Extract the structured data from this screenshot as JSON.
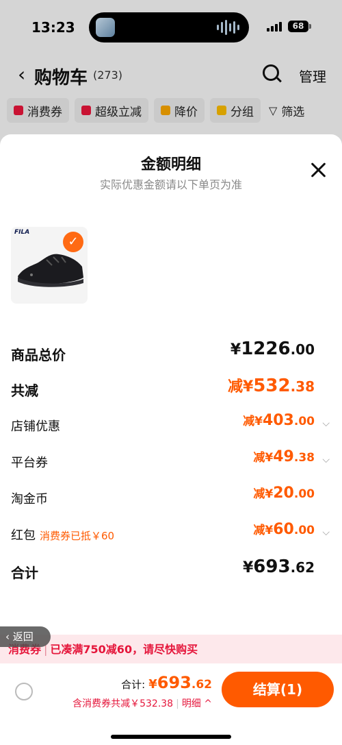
{
  "status_bar": {
    "time": "13:23",
    "battery": "68"
  },
  "nav": {
    "back_icon": "chevron-left-icon",
    "title": "购物车",
    "count": "(273)",
    "manage": "管理"
  },
  "filters": [
    {
      "label": "消费券",
      "icon": "coupon-icon",
      "color": "#e5163b"
    },
    {
      "label": "超级立减",
      "icon": "arrow-down-icon",
      "color": "#e5163b"
    },
    {
      "label": "降价",
      "icon": "price-drop-icon",
      "color": "#f5a300"
    },
    {
      "label": "分组",
      "icon": "folder-icon",
      "color": "#f5b800"
    },
    {
      "label": "筛选",
      "icon": "funnel-icon",
      "color": "#333333"
    }
  ],
  "sheet": {
    "title": "金额明细",
    "subtitle": "实际优惠金额请以下单页为准",
    "product": {
      "brand": "FILA",
      "selected": true
    }
  },
  "breakdown": {
    "goods_total": {
      "label": "商品总价",
      "prefix": "¥",
      "int": "1226",
      "dec": ".00"
    },
    "total_reduce": {
      "label": "共减",
      "prefix": "减¥",
      "int": "532",
      "dec": ".38"
    },
    "store_discount": {
      "label": "店铺优惠",
      "prefix": "减¥",
      "int": "403",
      "dec": ".00"
    },
    "platform_coupon": {
      "label": "平台券",
      "prefix": "减¥",
      "int": "49",
      "dec": ".38"
    },
    "taojinbi": {
      "label": "淘金币",
      "prefix": "减¥",
      "int": "20",
      "dec": ".00"
    },
    "red_packet": {
      "label": "红包",
      "note": "消费券已抵￥60",
      "prefix": "减¥",
      "int": "60",
      "dec": ".00"
    },
    "sum": {
      "label": "合计",
      "prefix": "¥",
      "int": "693",
      "dec": ".62"
    }
  },
  "bottom": {
    "back_label": "返回",
    "promo_tag": "消费券",
    "promo_text": "已凑满750减60，请尽快购买",
    "total_label": "合计:",
    "total_prefix": "¥",
    "total_int": "693",
    "total_dec": ".62",
    "detail_text": "含消费券共减￥532.38",
    "detail_link": "明细",
    "pay_label": "结算(1)"
  },
  "colors": {
    "accent": "#ff5a00",
    "promo_red": "#e5163b"
  }
}
